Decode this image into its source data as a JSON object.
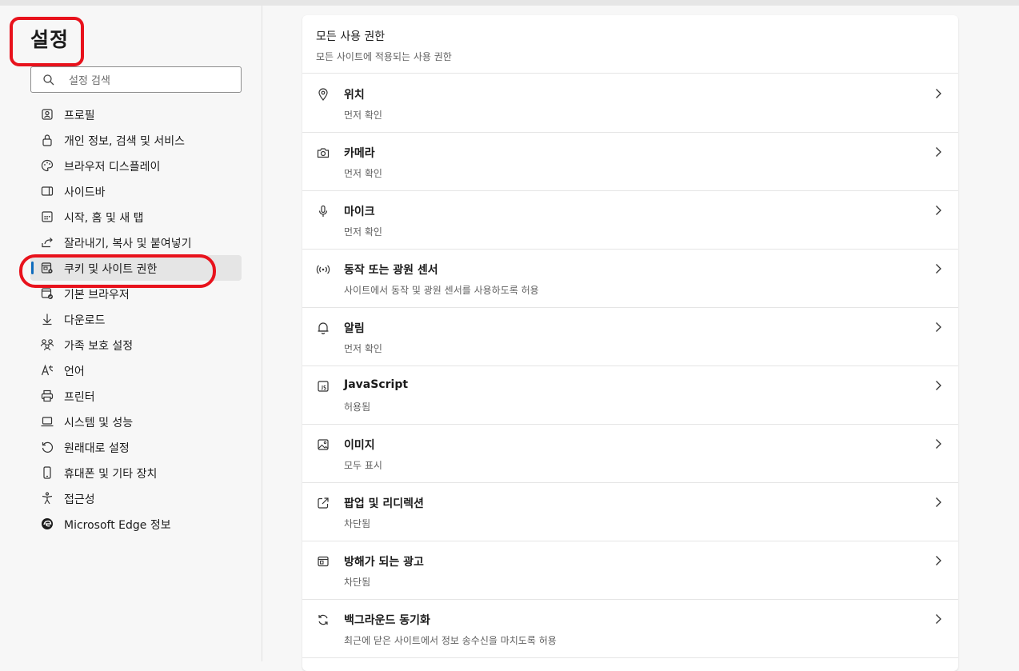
{
  "settings_title": "설정",
  "search": {
    "placeholder": "설정 검색"
  },
  "sidebar": {
    "items": [
      {
        "label": "프로필",
        "icon": "profile-icon"
      },
      {
        "label": "개인 정보, 검색 및 서비스",
        "icon": "lock-icon"
      },
      {
        "label": "브라우저 디스플레이",
        "icon": "palette-icon"
      },
      {
        "label": "사이드바",
        "icon": "sidebar-icon"
      },
      {
        "label": "시작, 홈 및 새 탭",
        "icon": "new-tab-icon"
      },
      {
        "label": "잘라내기, 복사 및 붙여넣기",
        "icon": "share-icon"
      },
      {
        "label": "쿠키 및 사이트 권한",
        "icon": "site-permissions-icon",
        "selected": true
      },
      {
        "label": "기본 브라우저",
        "icon": "default-browser-icon"
      },
      {
        "label": "다운로드",
        "icon": "download-icon"
      },
      {
        "label": "가족 보호 설정",
        "icon": "family-icon"
      },
      {
        "label": "언어",
        "icon": "language-icon"
      },
      {
        "label": "프린터",
        "icon": "printer-icon"
      },
      {
        "label": "시스템 및 성능",
        "icon": "laptop-icon"
      },
      {
        "label": "원래대로 설정",
        "icon": "reset-icon"
      },
      {
        "label": "휴대폰 및 기타 장치",
        "icon": "phone-icon"
      },
      {
        "label": "접근성",
        "icon": "accessibility-icon"
      },
      {
        "label": "Microsoft Edge 정보",
        "icon": "edge-logo-icon"
      }
    ]
  },
  "main": {
    "section_title": "모든 사용 권한",
    "section_subtitle": "모든 사이트에 적용되는 사용 권한",
    "permissions": [
      {
        "title": "위치",
        "status": "먼저 확인",
        "icon": "location-icon"
      },
      {
        "title": "카메라",
        "status": "먼저 확인",
        "icon": "camera-icon"
      },
      {
        "title": "마이크",
        "status": "먼저 확인",
        "icon": "microphone-icon"
      },
      {
        "title": "동작 또는 광원 센서",
        "status": "사이트에서 동작 및 광원 센서를 사용하도록 허용",
        "icon": "sensor-icon"
      },
      {
        "title": "알림",
        "status": "먼저 확인",
        "icon": "bell-icon"
      },
      {
        "title": "JavaScript",
        "status": "허용됨",
        "icon": "javascript-icon"
      },
      {
        "title": "이미지",
        "status": "모두 표시",
        "icon": "image-icon"
      },
      {
        "title": "팝업 및 리디렉션",
        "status": "차단됨",
        "icon": "popup-icon"
      },
      {
        "title": "방해가 되는 광고",
        "status": "차단됨",
        "icon": "ads-icon"
      },
      {
        "title": "백그라운드 동기화",
        "status": "최근에 닫은 사이트에서 정보 송수신을 마치도록 허용",
        "icon": "sync-icon"
      }
    ]
  },
  "colors": {
    "accent": "#0f6cbd",
    "highlight": "#e8121c"
  }
}
